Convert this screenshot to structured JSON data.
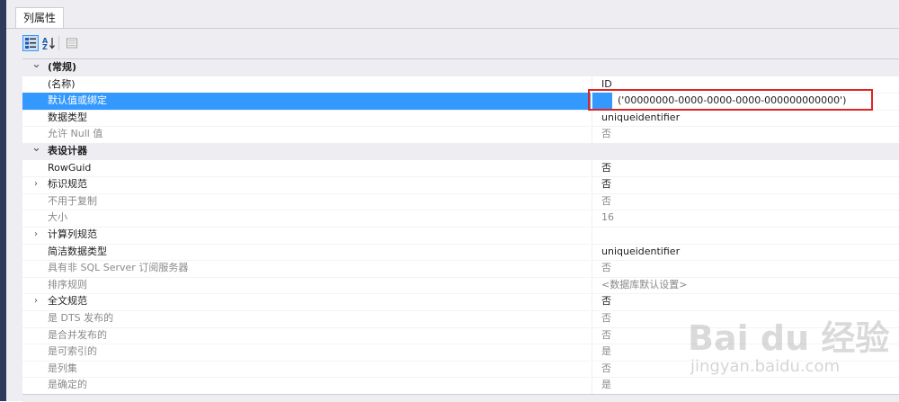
{
  "panel": {
    "tab_label": "列属性"
  },
  "toolbar": {
    "buttons": [
      {
        "name": "categorized-view",
        "icon": "categorized-icon",
        "active": true
      },
      {
        "name": "alphabetical-view",
        "icon": "sort-az-icon",
        "active": false
      },
      {
        "name": "property-pages",
        "icon": "property-pages-icon",
        "active": false
      }
    ]
  },
  "rows": [
    {
      "type": "category",
      "expand": "expanded",
      "label": "(常规)",
      "value": ""
    },
    {
      "type": "normal",
      "label": "(名称)",
      "value": "ID"
    },
    {
      "type": "selected",
      "label": "默认值或绑定",
      "value": "('00000000-0000-0000-0000-000000000000')"
    },
    {
      "type": "normal",
      "label": "数据类型",
      "value": "uniqueidentifier"
    },
    {
      "type": "disabled",
      "label": "允许 Null 值",
      "value": "否"
    },
    {
      "type": "category",
      "expand": "expanded",
      "label": "表设计器",
      "value": ""
    },
    {
      "type": "normal",
      "label": "RowGuid",
      "value": "否"
    },
    {
      "type": "normal",
      "expand": "collapsed",
      "label": "标识规范",
      "value": "否"
    },
    {
      "type": "disabled",
      "label": "不用于复制",
      "value": "否"
    },
    {
      "type": "disabled",
      "label": "大小",
      "value": "16"
    },
    {
      "type": "normal",
      "expand": "collapsed",
      "label": "计算列规范",
      "value": ""
    },
    {
      "type": "normal",
      "label": "简洁数据类型",
      "value": "uniqueidentifier"
    },
    {
      "type": "disabled",
      "label": "具有非 SQL Server 订阅服务器",
      "value": "否"
    },
    {
      "type": "disabled",
      "label": "排序规则",
      "value": "<数据库默认设置>"
    },
    {
      "type": "normal",
      "expand": "collapsed",
      "label": "全文规范",
      "value": "否"
    },
    {
      "type": "disabled",
      "label": "是 DTS 发布的",
      "value": "否"
    },
    {
      "type": "disabled",
      "label": "是合并发布的",
      "value": "否"
    },
    {
      "type": "disabled",
      "label": "是可索引的",
      "value": "是"
    },
    {
      "type": "disabled",
      "label": "是列集",
      "value": "否"
    },
    {
      "type": "disabled",
      "label": "是确定的",
      "value": "是"
    }
  ],
  "watermark": {
    "brand": "Bai du 经验",
    "url": "jingyan.baidu.com"
  },
  "colors": {
    "selection": "#3399ff",
    "highlight_box": "#e02424",
    "frame": "#2d3a5c"
  }
}
